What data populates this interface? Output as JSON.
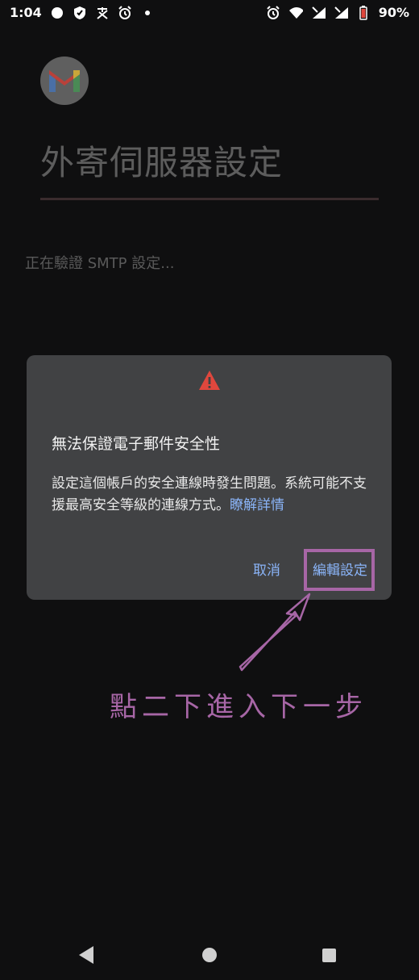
{
  "status_bar": {
    "time": "1:04",
    "battery_percent": "90%",
    "left_icons": [
      "record-dot-icon",
      "shield-icon",
      "pay-icon",
      "alarm-icon",
      "dot-icon"
    ],
    "right_icons": [
      "alarm-icon",
      "wifi-call-icon",
      "signal-call-icon",
      "signal-call-icon",
      "battery-icon"
    ]
  },
  "app": {
    "logo_icon": "gmail-logo-icon",
    "title": "外寄伺服器設定",
    "status_text": "正在驗證 SMTP 設定..."
  },
  "dialog": {
    "icon": "warning-icon",
    "title": "無法保證電子郵件安全性",
    "body": "設定這個帳戶的安全連線時發生問題。系統可能不支援最高安全等級的連線方式。",
    "link": "瞭解詳情",
    "cancel_label": "取消",
    "edit_label": "編輯設定"
  },
  "annotation": {
    "text": "點二下進入下一步",
    "color": "#a766a6"
  },
  "colors": {
    "accent_link": "#8ab4f8",
    "dialog_bg": "#414244",
    "warning": "#e0473d"
  }
}
